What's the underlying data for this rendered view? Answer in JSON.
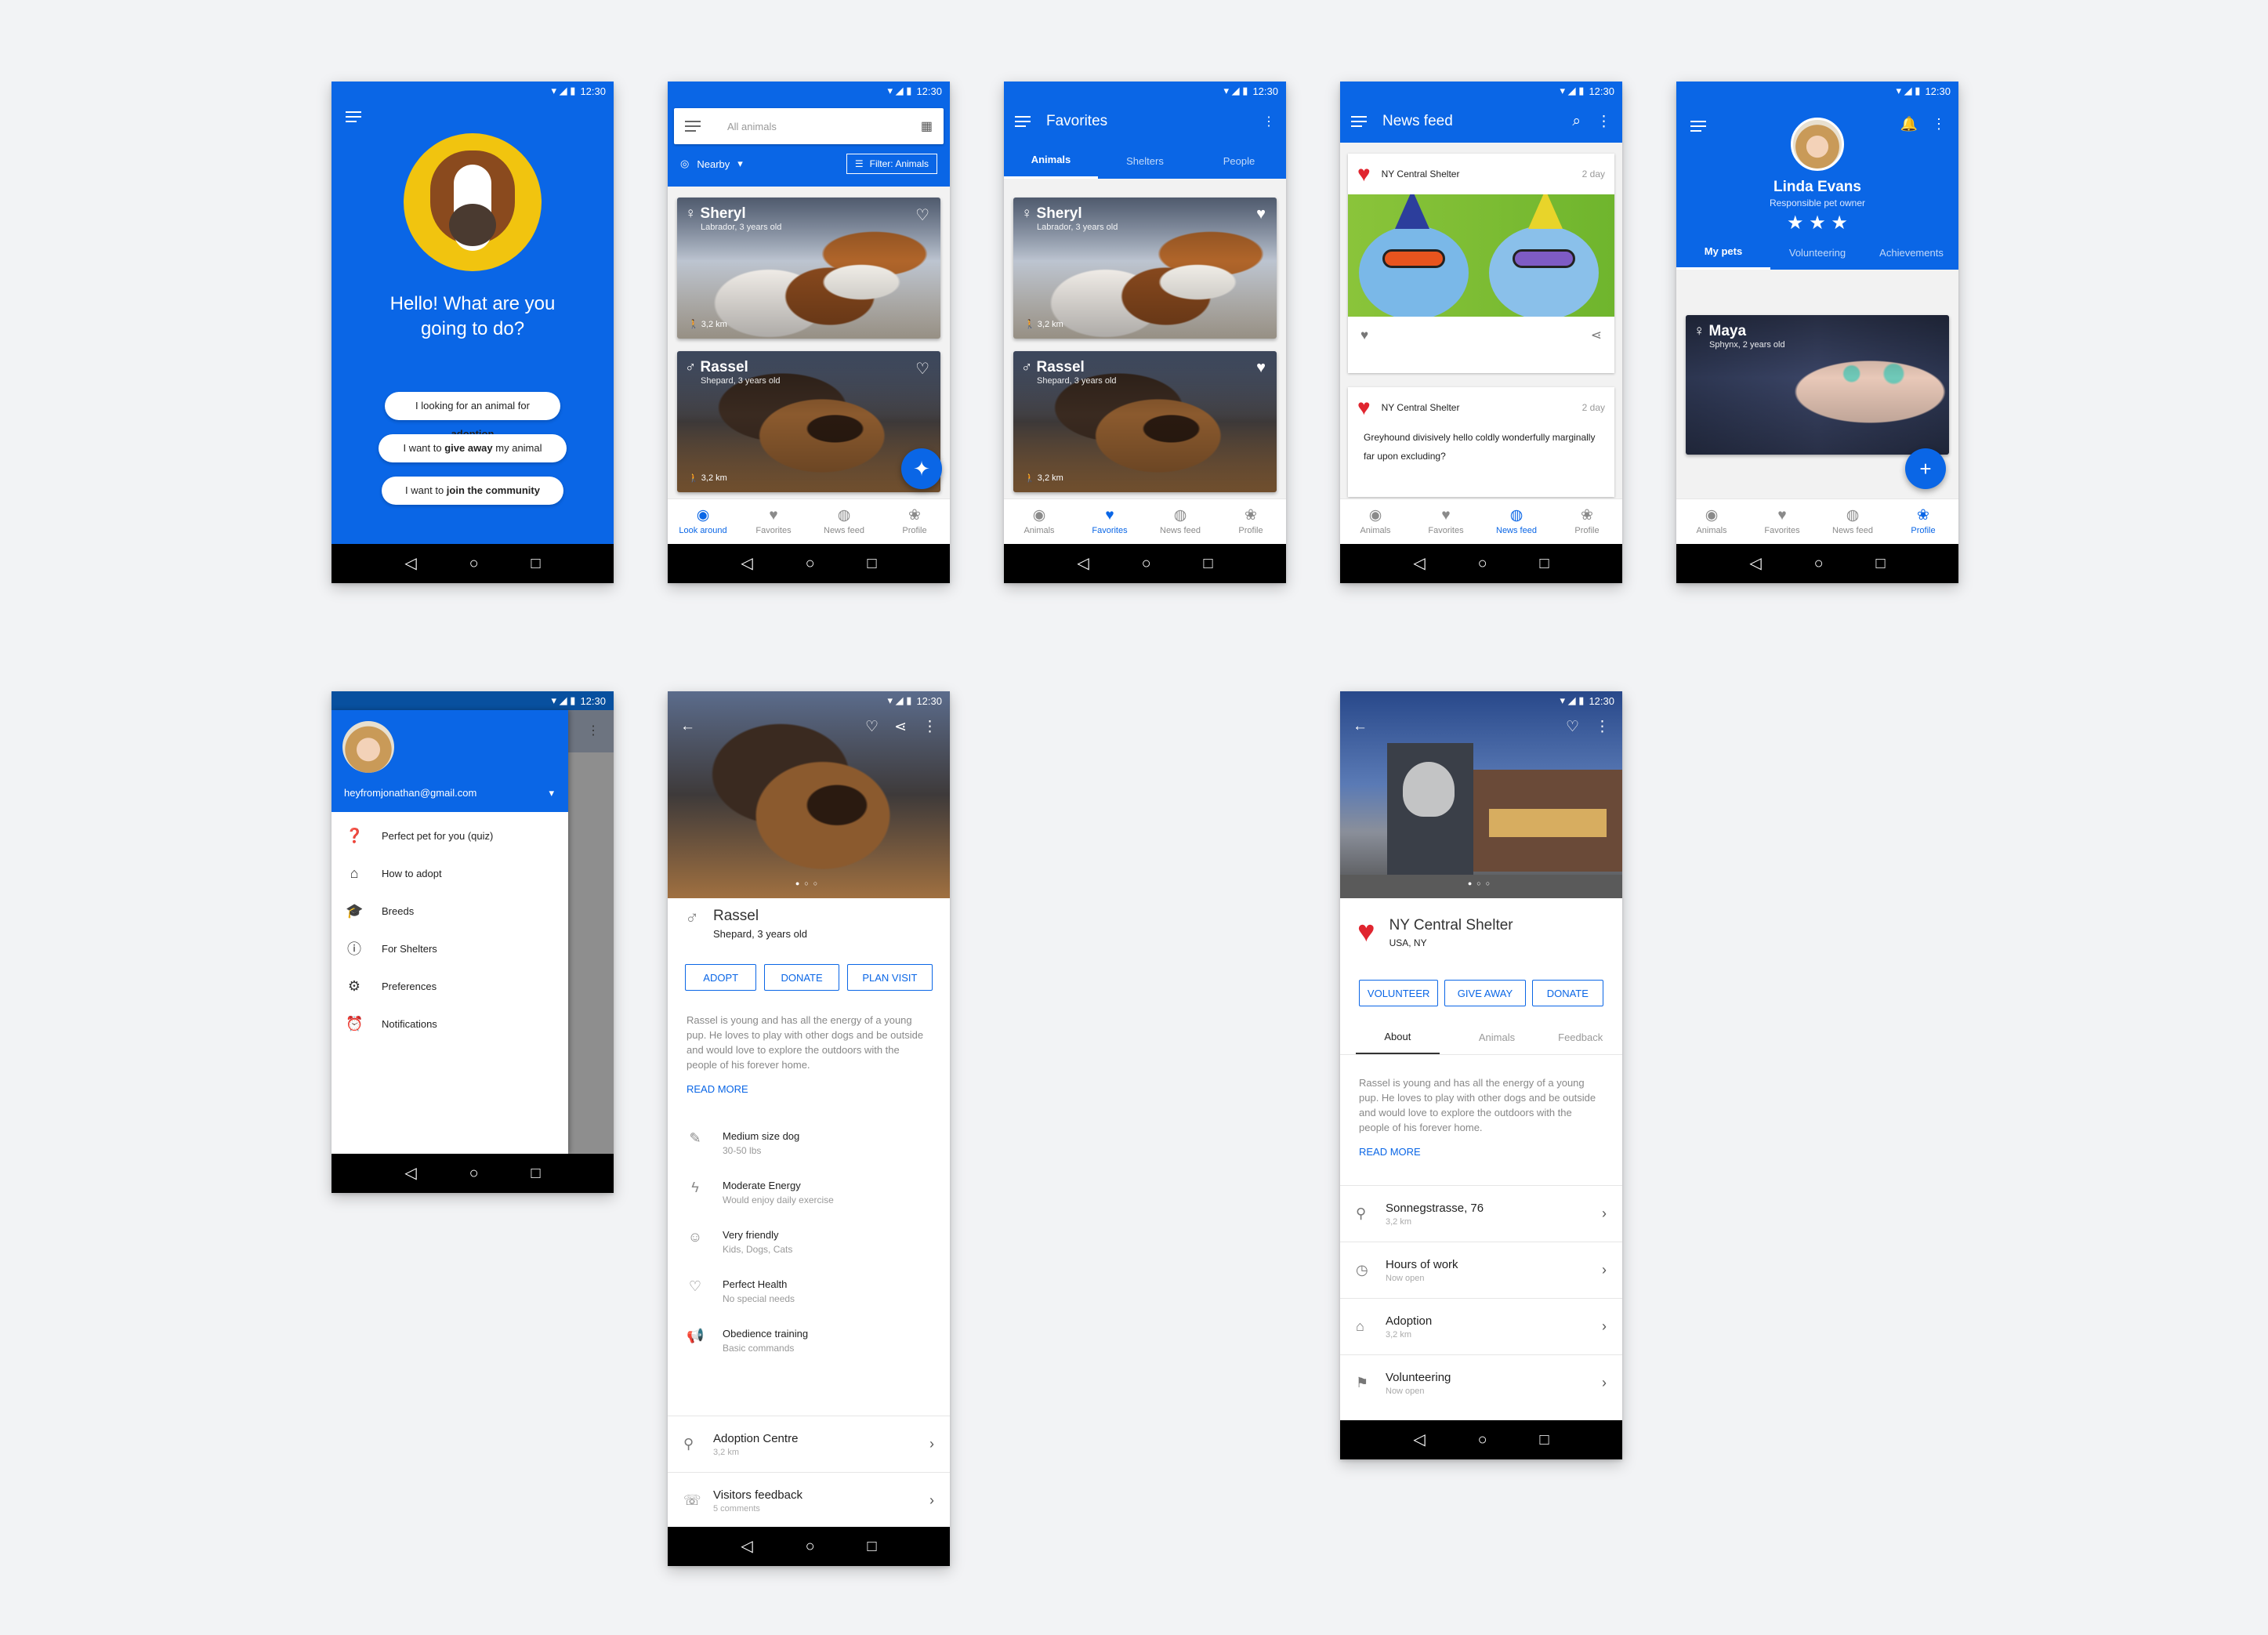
{
  "status_time": "12:30",
  "nav": {
    "back": "◁",
    "home": "○",
    "recent": "□"
  },
  "welcome": {
    "greeting": "Hello! What are you going to do?",
    "options": [
      {
        "pre": "I looking for an animal for ",
        "bold": "adoption",
        "post": ""
      },
      {
        "pre": "I want to ",
        "bold": "give away",
        "post": " my animal"
      },
      {
        "pre": "I want to ",
        "bold": "join the community",
        "post": ""
      }
    ]
  },
  "look_around": {
    "search_placeholder": "All animals",
    "nearby": "Nearby",
    "filter": "Filter: Animals",
    "bottom_nav": [
      "Look around",
      "Favorites",
      "News feed",
      "Profile"
    ]
  },
  "animals": [
    {
      "name": "Sheryl",
      "gender": "♀",
      "sub": "Labrador, 3 years old",
      "dist": "3,2 km"
    },
    {
      "name": "Rassel",
      "gender": "♂",
      "sub": "Shepard, 3 years old",
      "dist": "3,2 km"
    }
  ],
  "favorites": {
    "title": "Favorites",
    "tabs": [
      "Animals",
      "Shelters",
      "People"
    ],
    "bottom_nav": [
      "Animals",
      "Favorites",
      "News feed",
      "Profile"
    ]
  },
  "news": {
    "title": "News feed",
    "posts": [
      {
        "author": "NY Central Shelter",
        "time": "2 day"
      },
      {
        "author": "NY Central Shelter",
        "time": "2 day",
        "text": "Greyhound divisively hello coldly wonderfully marginally far upon excluding?"
      }
    ],
    "bottom_nav": [
      "Animals",
      "Favorites",
      "News feed",
      "Profile"
    ]
  },
  "profile": {
    "name": "Linda Evans",
    "role": "Responsible pet owner",
    "stars": "★ ★ ★",
    "tabs": [
      "My pets",
      "Volunteering",
      "Achievements"
    ],
    "pet": {
      "name": "Maya",
      "gender": "♀",
      "sub": "Sphynx, 2 years old"
    },
    "bottom_nav": [
      "Animals",
      "Favorites",
      "News feed",
      "Profile"
    ]
  },
  "drawer": {
    "email": "heyfromjonathan@gmail.com",
    "items": [
      "Perfect pet for you (quiz)",
      "How to adopt",
      "Breeds",
      "For Shelters",
      "Preferences",
      "Notifications"
    ]
  },
  "detail": {
    "name": "Rassel",
    "gender": "♂",
    "sub": "Shepard, 3 years old",
    "buttons": [
      "ADOPT",
      "DONATE",
      "PLAN VISIT"
    ],
    "description": "Rassel is young and has all the energy of a young pup. He loves to play with other dogs and be outside and would love to explore the outdoors with the people of his forever home.",
    "read_more": "READ MORE",
    "traits": [
      {
        "title": "Medium size dog",
        "sub": "30-50 lbs"
      },
      {
        "title": "Moderate Energy",
        "sub": "Would enjoy daily exercise"
      },
      {
        "title": "Very friendly",
        "sub": "Kids, Dogs, Cats"
      },
      {
        "title": "Perfect Health",
        "sub": "No special needs"
      },
      {
        "title": "Obedience training",
        "sub": "Basic commands"
      }
    ],
    "links": [
      {
        "title": "Adoption Centre",
        "sub": "3,2 km"
      },
      {
        "title": "Visitors feedback",
        "sub": "5 comments"
      }
    ]
  },
  "shelter": {
    "name": "NY Central Shelter",
    "location": "USA, NY",
    "buttons": [
      "VOLUNTEER",
      "GIVE AWAY",
      "DONATE"
    ],
    "tabs": [
      "About",
      "Animals",
      "Feedback"
    ],
    "description": "Rassel is young and has all the energy of a young pup. He loves to play with other dogs and be outside and would love to explore the outdoors with the people of his forever home.",
    "read_more": "READ MORE",
    "rows": [
      {
        "title": "Sonnegstrasse, 76",
        "sub": "3,2 km"
      },
      {
        "title": "Hours of work",
        "sub": "Now open"
      },
      {
        "title": "Adoption",
        "sub": "3,2 km"
      },
      {
        "title": "Volunteering",
        "sub": "Now open"
      }
    ]
  }
}
